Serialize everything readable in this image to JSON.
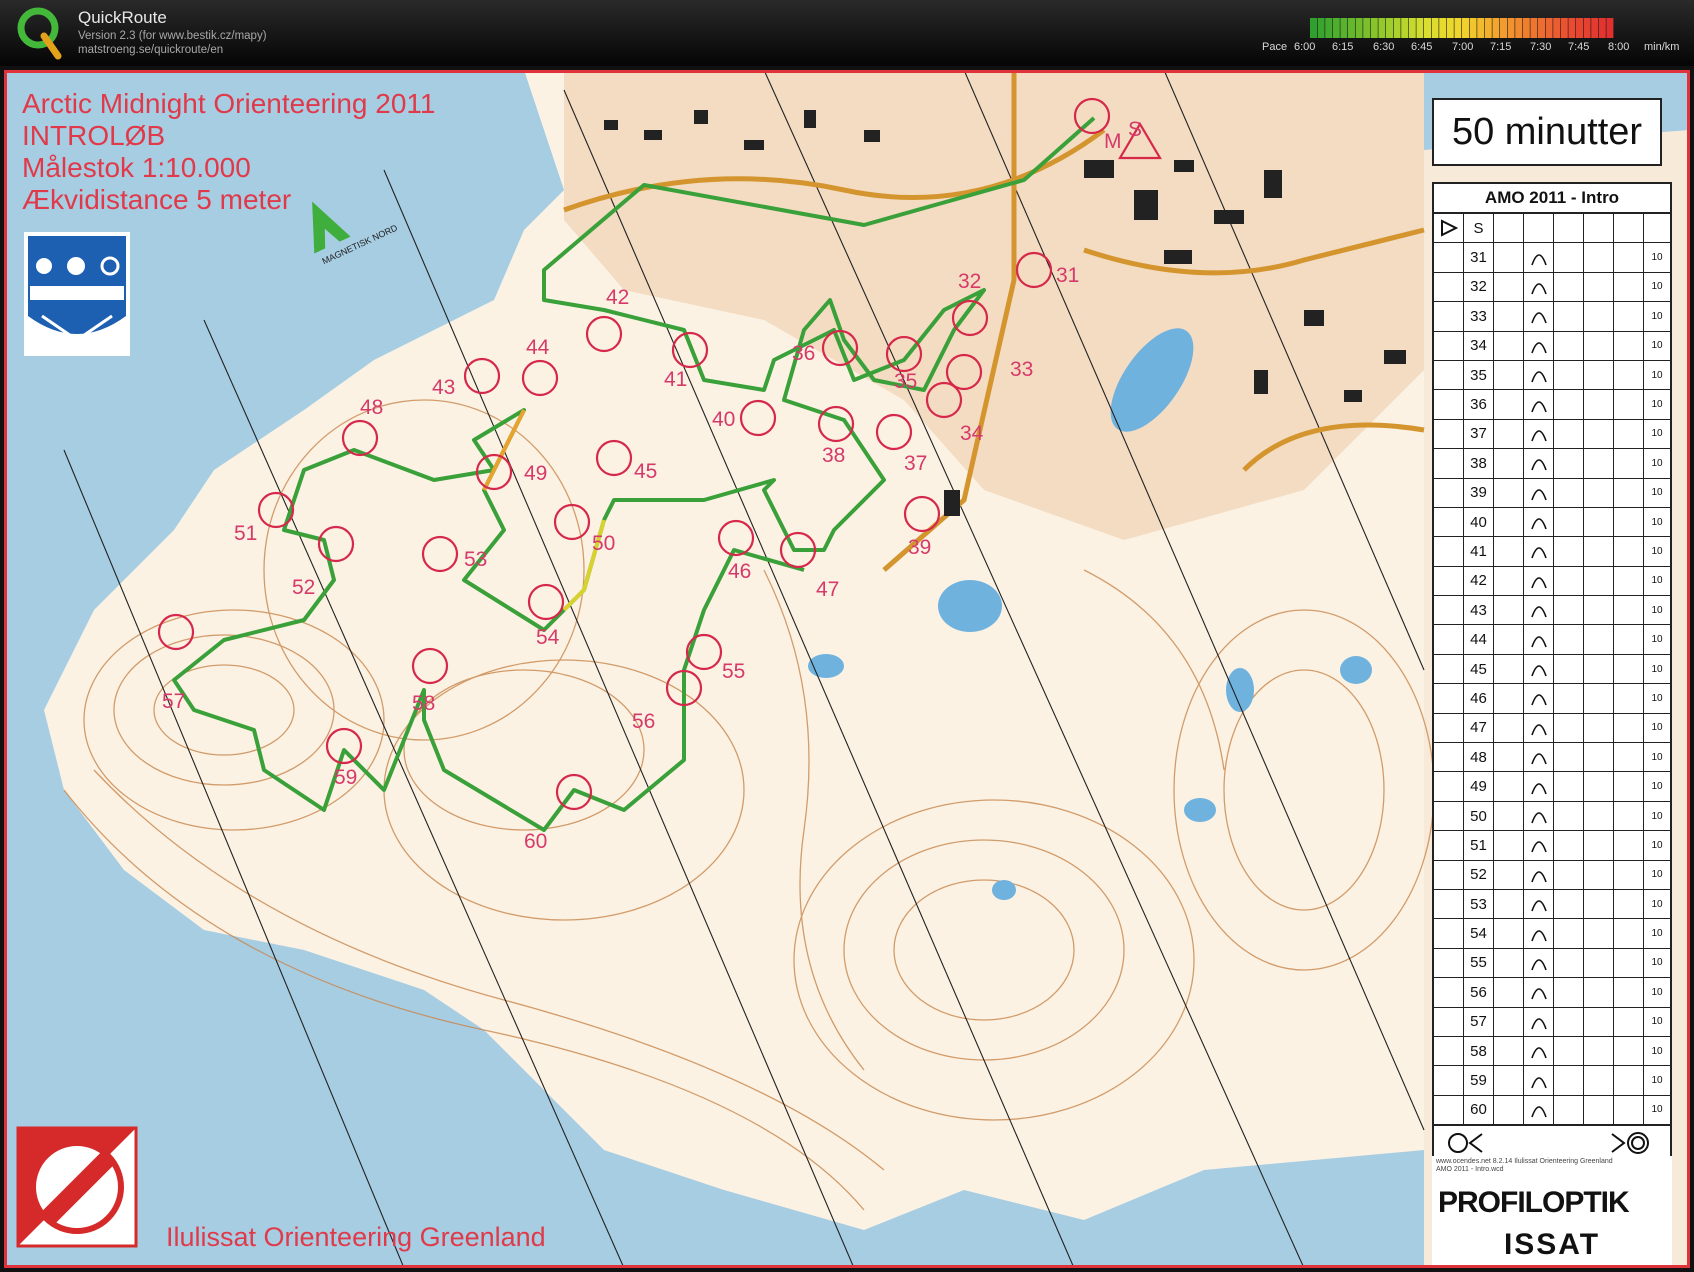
{
  "app": {
    "name": "QuickRoute",
    "version": "Version 2.3  (for www.bestik.cz/mapy)",
    "url": "matstroeng.se/quickroute/en"
  },
  "pace_scale": {
    "prefix": "Pace",
    "ticks": [
      "6:00",
      "6:15",
      "6:30",
      "6:45",
      "7:00",
      "7:15",
      "7:30",
      "7:45",
      "8:00"
    ],
    "unit": "min/km",
    "colors": [
      "#2fa02f",
      "#62b62c",
      "#9ccc2b",
      "#d8df2e",
      "#f2d52c",
      "#f2a22d",
      "#ee7330",
      "#e84a30",
      "#e03030"
    ]
  },
  "map": {
    "title_lines": [
      "Arctic Midnight Orienteering 2011",
      "INTROLØB",
      "Målestok 1:10.000",
      "Ækvidistance 5 meter"
    ],
    "north_label": "MAGNETISK NORD",
    "start_label": "S",
    "finish_label": "M",
    "time_limit": "50 minutter",
    "footer": "Ilulissat Orienteering Greenland",
    "club_logo_text": "ILULISSAT ORIENTEERING GREENLAND",
    "controls": [
      "31",
      "32",
      "33",
      "34",
      "35",
      "36",
      "37",
      "38",
      "39",
      "40",
      "41",
      "42",
      "43",
      "44",
      "45",
      "46",
      "47",
      "48",
      "49",
      "50",
      "51",
      "52",
      "53",
      "54",
      "55",
      "56",
      "57",
      "58",
      "59",
      "60"
    ]
  },
  "control_description": {
    "title": "AMO 2011  -  Intro",
    "start_code": "S",
    "rows": [
      {
        "num": "31",
        "pts": "10"
      },
      {
        "num": "32",
        "pts": "10"
      },
      {
        "num": "33",
        "pts": "10"
      },
      {
        "num": "34",
        "pts": "10"
      },
      {
        "num": "35",
        "pts": "10"
      },
      {
        "num": "36",
        "pts": "10"
      },
      {
        "num": "37",
        "pts": "10"
      },
      {
        "num": "38",
        "pts": "10"
      },
      {
        "num": "39",
        "pts": "10"
      },
      {
        "num": "40",
        "pts": "10"
      },
      {
        "num": "41",
        "pts": "10"
      },
      {
        "num": "42",
        "pts": "10"
      },
      {
        "num": "43",
        "pts": "10"
      },
      {
        "num": "44",
        "pts": "10"
      },
      {
        "num": "45",
        "pts": "10"
      },
      {
        "num": "46",
        "pts": "10"
      },
      {
        "num": "47",
        "pts": "10"
      },
      {
        "num": "48",
        "pts": "10"
      },
      {
        "num": "49",
        "pts": "10"
      },
      {
        "num": "50",
        "pts": "10"
      },
      {
        "num": "51",
        "pts": "10"
      },
      {
        "num": "52",
        "pts": "10"
      },
      {
        "num": "53",
        "pts": "10"
      },
      {
        "num": "54",
        "pts": "10"
      },
      {
        "num": "55",
        "pts": "10"
      },
      {
        "num": "56",
        "pts": "10"
      },
      {
        "num": "57",
        "pts": "10"
      },
      {
        "num": "58",
        "pts": "10"
      },
      {
        "num": "59",
        "pts": "10"
      },
      {
        "num": "60",
        "pts": "10"
      }
    ]
  },
  "sponsor": {
    "fine_print_1": "www.ocendes.net 8.2.14  Ilulissat Orienteering Greenland",
    "fine_print_2": "AMO 2011 - Intro.wcd",
    "name": "PROFILOPTIK",
    "town": "ISSAT"
  }
}
